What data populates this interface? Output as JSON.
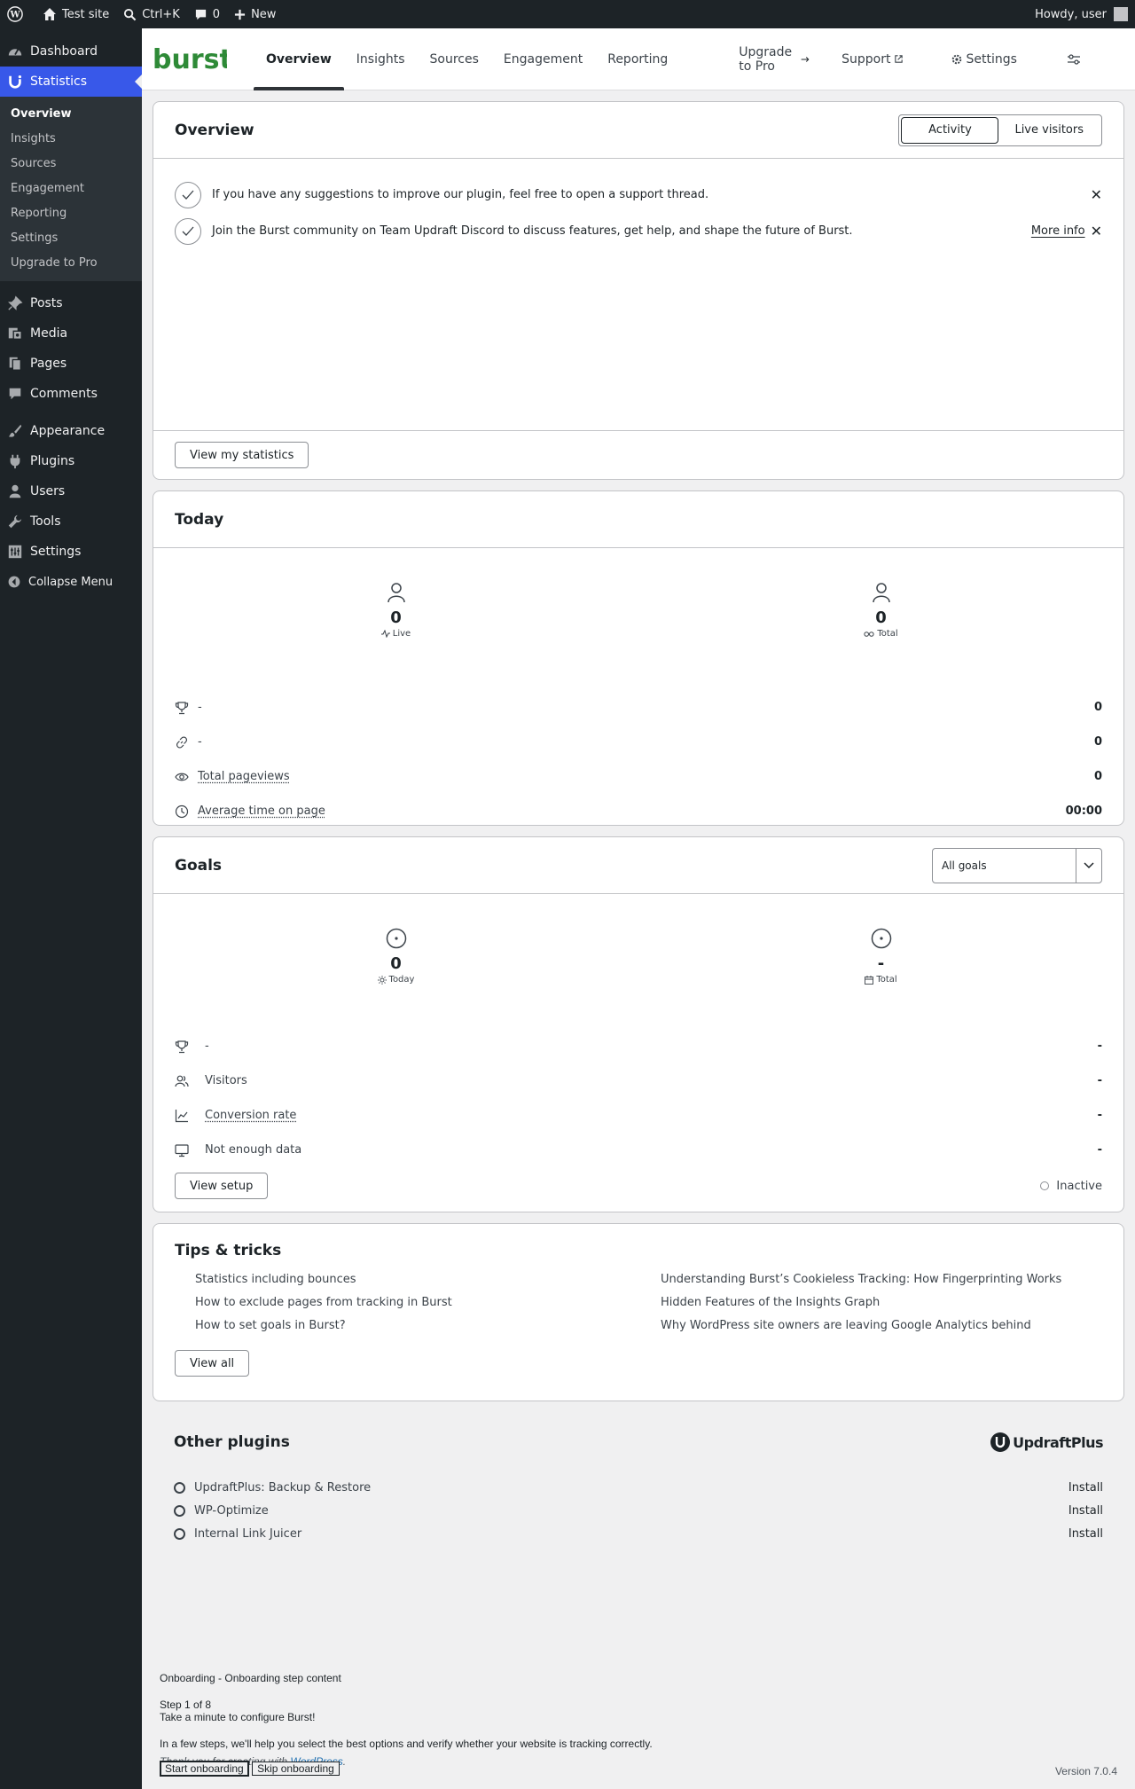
{
  "adminbar": {
    "site_name": "Test site",
    "search_shortcut": "Ctrl+K",
    "comments_count": "0",
    "new_label": "New",
    "howdy": "Howdy, user"
  },
  "sidebar": {
    "dashboard": "Dashboard",
    "statistics": "Statistics",
    "sub": [
      "Overview",
      "Insights",
      "Sources",
      "Engagement",
      "Reporting",
      "Settings",
      "Upgrade to Pro"
    ],
    "posts": "Posts",
    "media": "Media",
    "pages": "Pages",
    "comments": "Comments",
    "appearance": "Appearance",
    "plugins": "Plugins",
    "users": "Users",
    "tools": "Tools",
    "settings": "Settings",
    "collapse": "Collapse Menu"
  },
  "topnav": {
    "logo": "burst",
    "tabs": [
      "Overview",
      "Insights",
      "Sources",
      "Engagement",
      "Reporting"
    ],
    "upgrade": "Upgrade to Pro",
    "support": "Support",
    "settings": "Settings"
  },
  "overview": {
    "title": "Overview",
    "toggle_activity": "Activity",
    "toggle_live": "Live visitors",
    "notices": [
      "If you have any suggestions to improve our plugin, feel free to open a support thread.",
      "Join the Burst community on Team Updraft Discord to discuss features, get help, and shape the future of Burst."
    ],
    "more_info": "More info",
    "view_button": "View my statistics"
  },
  "today": {
    "title": "Today",
    "live_value": "0",
    "live_label": "Live",
    "total_value": "0",
    "total_label": "Total",
    "rows": [
      {
        "label": "-",
        "value": "0"
      },
      {
        "label": "-",
        "value": "0"
      },
      {
        "label": "Total pageviews",
        "value": "0"
      },
      {
        "label": "Average time on page",
        "value": "00:00"
      }
    ]
  },
  "goals": {
    "title": "Goals",
    "select_value": "All goals",
    "today_value": "0",
    "today_label": "Today",
    "total_value": "-",
    "total_label": "Total",
    "rows": [
      {
        "label": "-",
        "value": "-"
      },
      {
        "label": "Visitors",
        "value": "-"
      },
      {
        "label": "Conversion rate",
        "value": "-"
      },
      {
        "label": "Not enough data",
        "value": "-"
      }
    ],
    "setup_button": "View setup",
    "status": "Inactive"
  },
  "tips": {
    "title": "Tips & tricks",
    "items": [
      "Statistics including bounces",
      "Understanding Burst’s Cookieless Tracking: How Fingerprinting Works",
      "How to exclude pages from tracking in Burst",
      "Hidden Features of the Insights Graph",
      "How to set goals in Burst?",
      "Why WordPress site owners are leaving Google Analytics behind"
    ],
    "view_all": "View all"
  },
  "other_plugins": {
    "title": "Other plugins",
    "brand": "UpdraftPlus",
    "items": [
      {
        "name": "UpdraftPlus: Backup & Restore",
        "action": "Install"
      },
      {
        "name": "WP-Optimize",
        "action": "Install"
      },
      {
        "name": "Internal Link Juicer",
        "action": "Install"
      }
    ]
  },
  "onboarding": {
    "heading": "Onboarding - Onboarding step content",
    "step": "Step 1 of 8",
    "subtitle": "Take a minute to configure Burst!",
    "desc": "In a few steps, we'll help you select the best options and verify whether your website is tracking correctly.",
    "thanks_prefix": "Thank you for creating with",
    "thanks_link": "WordPress",
    "start": "Start onboarding",
    "skip": "Skip onboarding"
  },
  "footer": {
    "version": "Version 7.0.4"
  },
  "colors": {
    "accent": "#3858e9",
    "brand_green": "#2e8a37",
    "admin_dark": "#1d2327"
  }
}
